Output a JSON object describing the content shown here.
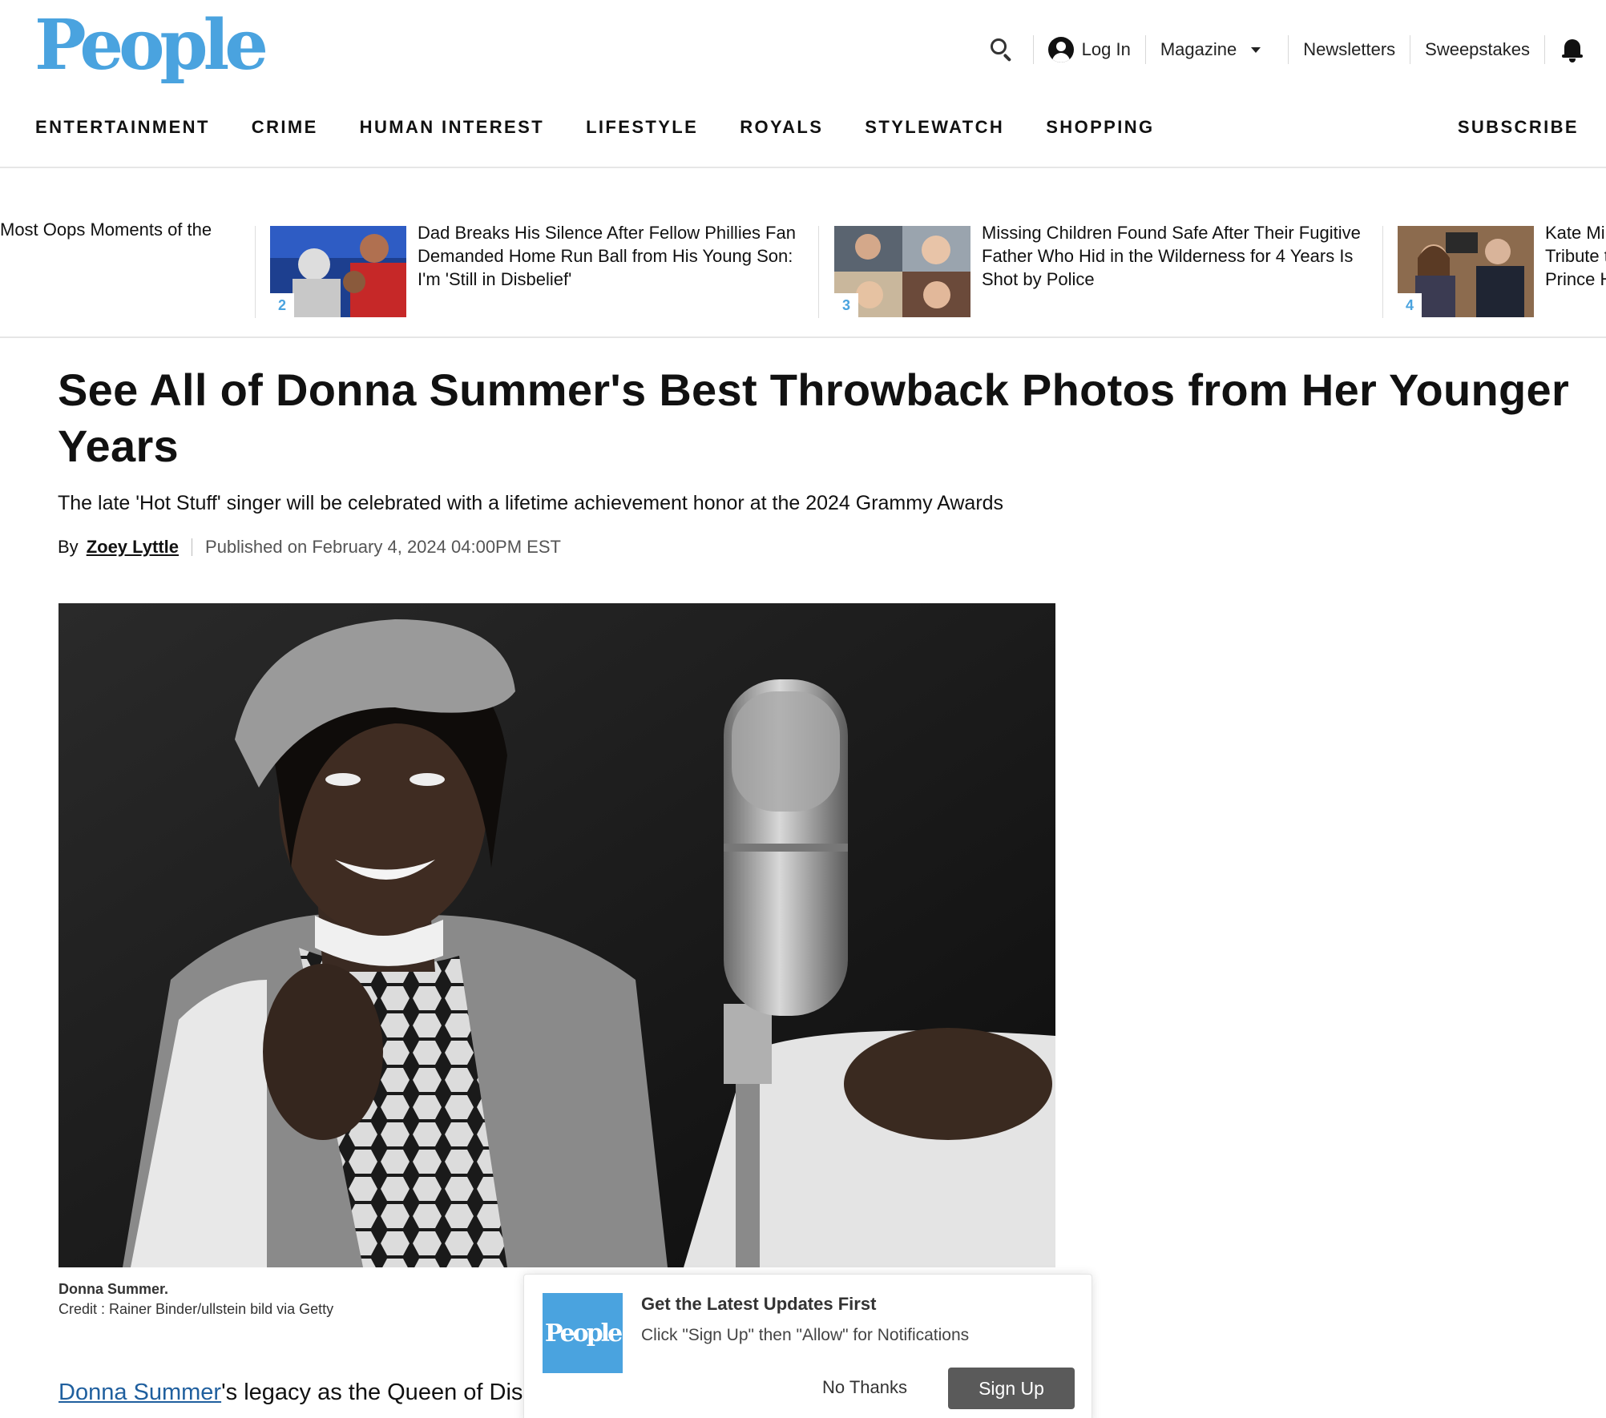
{
  "brand": {
    "logo_text": "People",
    "accent": "#4aa3df"
  },
  "utility": {
    "login": "Log In",
    "magazine": "Magazine",
    "newsletters": "Newsletters",
    "sweepstakes": "Sweepstakes"
  },
  "nav": {
    "items": [
      "ENTERTAINMENT",
      "CRIME",
      "HUMAN INTEREST",
      "LIFESTYLE",
      "ROYALS",
      "STYLEWATCH",
      "SHOPPING"
    ],
    "subscribe": "SUBSCRIBE"
  },
  "trending": [
    {
      "rank": "",
      "title": "Most Oops Moments of the"
    },
    {
      "rank": "2",
      "title": "Dad Breaks His Silence After Fellow Phillies Fan Demanded Home Run Ball from His Young Son: I'm 'Still in Disbelief'"
    },
    {
      "rank": "3",
      "title": "Missing Children Found Safe After Their Fugitive Father Who Hid in the Wilderness for 4 Years Is Shot by Police"
    },
    {
      "rank": "4",
      "title": "Kate Mi Tribute t Prince H"
    }
  ],
  "article": {
    "headline": "See All of Donna Summer's Best Throwback Photos from Her Younger Years",
    "dek": "The late 'Hot Stuff' singer will be celebrated with a lifetime achievement honor at the 2024 Grammy Awards",
    "by_label": "By",
    "author": "Zoey Lyttle",
    "published": "Published on February 4, 2024 04:00PM EST",
    "caption_title": "Donna Summer.",
    "caption_credit": "Credit : Rainer Binder/ullstein bild via Getty",
    "body_link": "Donna Summer",
    "body_rest": "'s legacy as the Queen of Disco"
  },
  "popup": {
    "logo_text": "People",
    "title": "Get the Latest Updates First",
    "message": "Click \"Sign Up\" then \"Allow\" for Notifications",
    "no_thanks": "No Thanks",
    "sign_up": "Sign Up"
  }
}
